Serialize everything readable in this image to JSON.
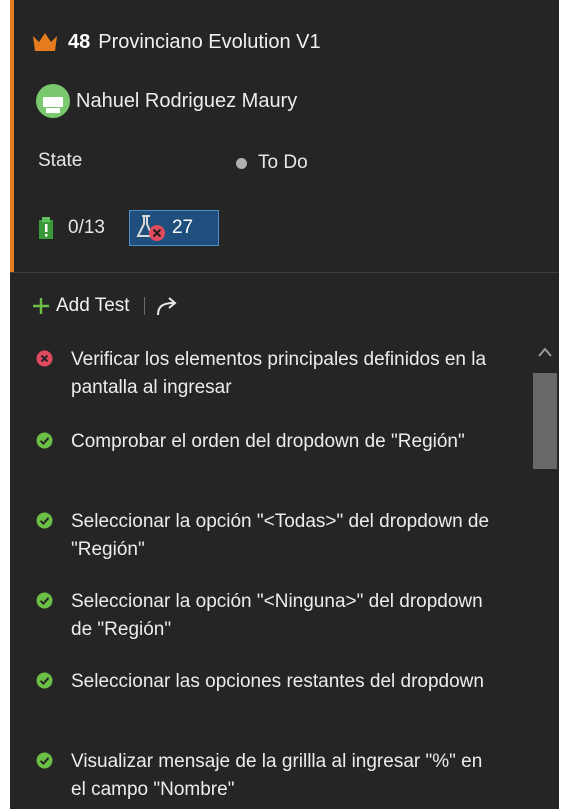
{
  "work_item": {
    "id": "48",
    "title": "Provinciano Evolution V1",
    "icon": "crown-icon",
    "accent_color": "#e57c1e"
  },
  "assignee": {
    "name": "Nahuel Rodriguez Maury",
    "avatar_color": "#7bc96f"
  },
  "state": {
    "label": "State",
    "value": "To Do",
    "dot_color": "#b0b0b0"
  },
  "metrics": {
    "tasks": "0/13",
    "tasks_icon": "clipboard-icon",
    "tests": "27",
    "tests_icon": "flask-failed-icon"
  },
  "toolbar": {
    "add_test_label": "Add Test"
  },
  "tests": [
    {
      "status": "failed",
      "text": "Verificar los elementos principales definidos en la pantalla al ingresar"
    },
    {
      "status": "passed",
      "text": "Comprobar el orden del dropdown de \"Región\""
    },
    {
      "status": "passed",
      "text": "Seleccionar la opción \"<Todas>\" del dropdown de \"Región\""
    },
    {
      "status": "passed",
      "text": "Seleccionar la opción \"<Ninguna>\" del dropdown de \"Región\""
    },
    {
      "status": "passed",
      "text": "Seleccionar las opciones restantes del dropdown"
    },
    {
      "status": "passed",
      "text": "Visualizar mensaje de la grillla al ingresar \"%\" en el campo \"Nombre\""
    }
  ],
  "colors": {
    "failed": "#e24a5f",
    "passed": "#6cbf45"
  }
}
